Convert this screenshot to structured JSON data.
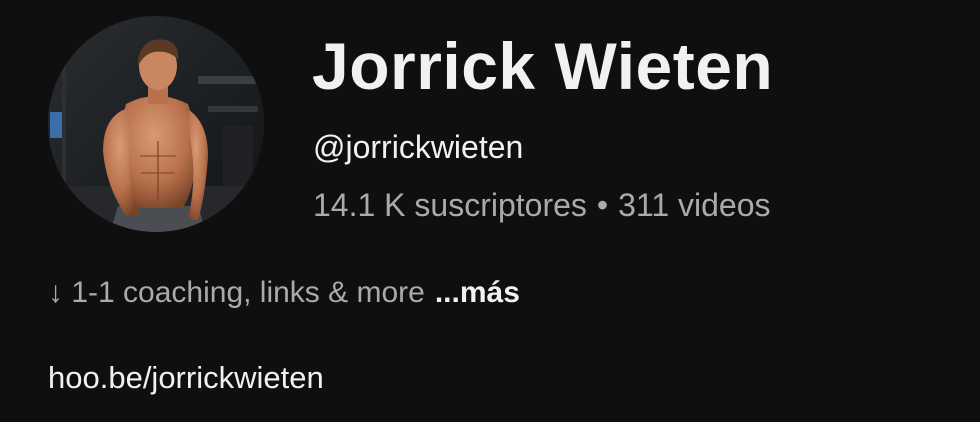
{
  "channel": {
    "name": "Jorrick Wieten",
    "handle": "@jorrickwieten",
    "subscribers": "14.1 K suscriptores",
    "separator": "•",
    "videos": "311 videos"
  },
  "description": {
    "arrow": "↓",
    "text": "1-1 coaching, links & more",
    "more_label": "...más"
  },
  "link": {
    "text": "hoo.be/jorrickwieten"
  },
  "colors": {
    "background": "#0f0f0f",
    "primary_text": "#f1f1f1",
    "secondary_text": "#aaaaaa"
  }
}
